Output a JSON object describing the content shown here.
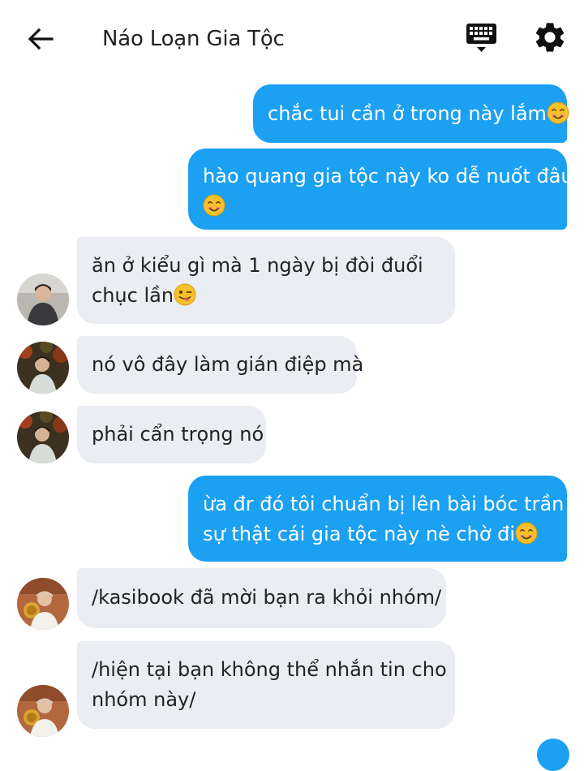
{
  "header": {
    "title": "Náo Loạn Gia Tộc",
    "back_icon": "arrow-left-icon",
    "keyboard_icon": "keyboard-icon",
    "settings_icon": "gear-icon"
  },
  "messages": [
    {
      "dir": "out",
      "lines": [
        "chắc tui cần ở trong này lắm"
      ],
      "emoji": "smiling-face"
    },
    {
      "dir": "out",
      "lines": [
        "hào quang gia tộc này ko dễ nuốt đâu",
        ""
      ],
      "emoji": "smiling-face"
    },
    {
      "dir": "in",
      "lines": [
        "ăn ở kiểu gì mà 1 ngày bị đòi đuổi",
        "chục lần"
      ],
      "emoji": "winking-face-with-tongue"
    },
    {
      "dir": "in",
      "lines": [
        "nó vô đây làm gián điệp mà"
      ]
    },
    {
      "dir": "in",
      "lines": [
        "phải cẩn trọng nó"
      ]
    },
    {
      "dir": "out",
      "lines": [
        "ừa đr đó tôi chuẩn bị lên bài bóc trần",
        "sự thật cái gia tộc này nè chờ đi"
      ],
      "emoji": "smiling-face"
    },
    {
      "dir": "in",
      "lines": [
        "/kasibook đã mời bạn ra khỏi nhóm/"
      ]
    },
    {
      "dir": "in",
      "lines": [
        "/hiện tại bạn không thể nhắn tin cho",
        "nhóm này/"
      ]
    }
  ],
  "colors": {
    "outgoing_bubble": "#1ba0f2",
    "incoming_bubble": "#eaedf1"
  }
}
